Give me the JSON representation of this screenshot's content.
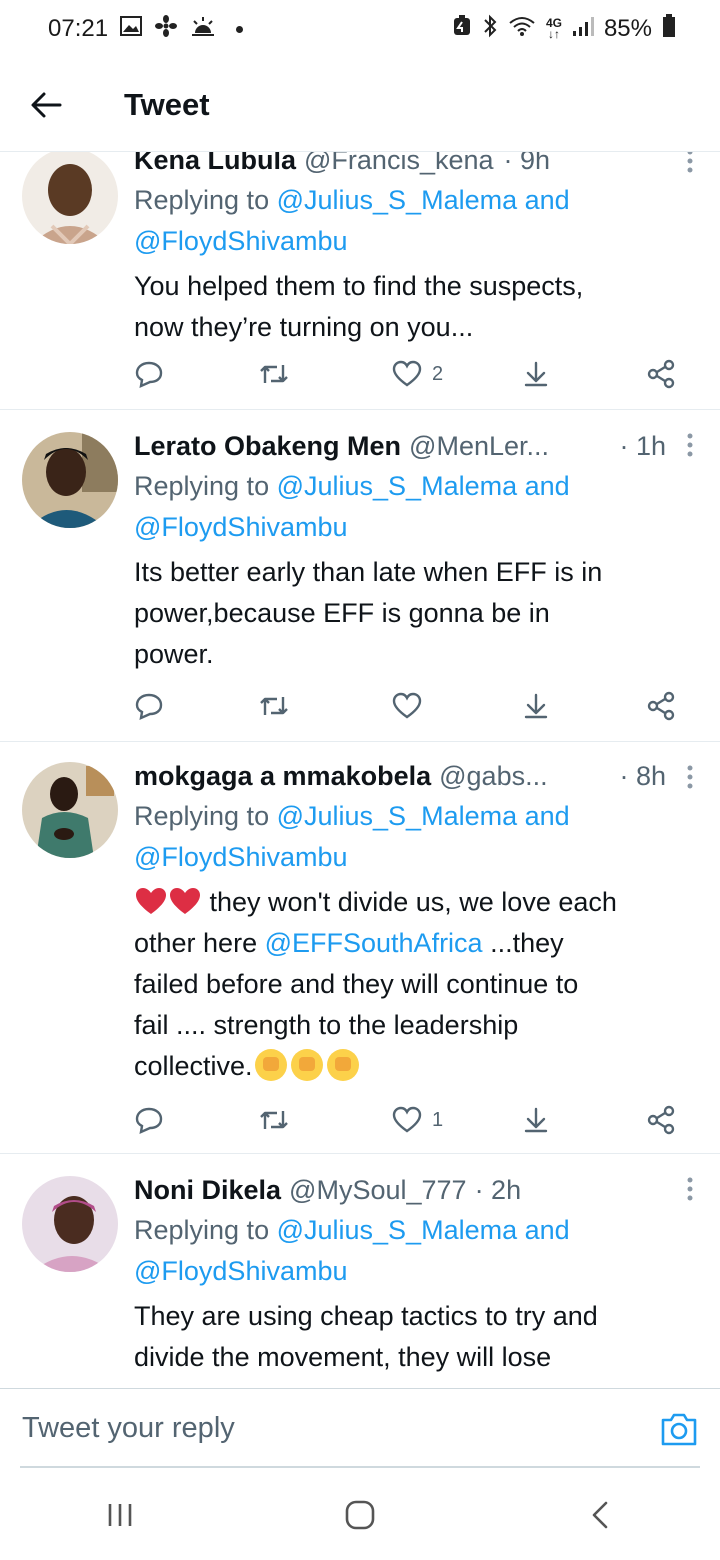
{
  "status_bar": {
    "time": "07:21",
    "left_icons": [
      "gallery-icon",
      "fan-icon",
      "weather-icon",
      "notification-dot"
    ],
    "right_icons": [
      "battery-saver-icon",
      "bluetooth-icon",
      "wifi-icon",
      "network-4g-icon",
      "signal-icon"
    ],
    "network": "4G",
    "battery": "85%"
  },
  "header": {
    "title": "Tweet",
    "back_icon": "arrow-left-icon"
  },
  "tweets": [
    {
      "name": "Kena Lubula",
      "handle": "@Francis_kena",
      "time": "· 9h",
      "reply_prefix": "Replying to ",
      "reply_user1": "@Julius_S_Malema",
      "reply_and": " and",
      "reply_user2": "@FloydShivambu",
      "text_lines": [
        "You helped them to find the suspects,",
        "now they’re turning on you..."
      ],
      "likes": "2"
    },
    {
      "name": "Lerato Obakeng Men",
      "handle": "@MenLer...",
      "time": "· 1h",
      "reply_prefix": "Replying to ",
      "reply_user1": "@Julius_S_Malema",
      "reply_and": " and",
      "reply_user2": "@FloydShivambu",
      "text_lines": [
        "Its better early than late when EFF is in",
        "power,because EFF is gonna be in",
        "power."
      ],
      "likes": ""
    },
    {
      "name": "mokgaga a mmakobela",
      "handle": "@gabs...",
      "time": "· 8h",
      "reply_prefix": "Replying to ",
      "reply_user1": "@Julius_S_Malema",
      "reply_and": " and",
      "reply_user2": "@FloydShivambu",
      "text_line1": " they won't divide us, we love each",
      "text_line2_pre": "other here ",
      "text_mention": "@EFFSouthAfrica",
      "text_line2_post": " ...they",
      "text_lines_rest": [
        "failed before and they will continue to",
        "fail .... strength to the leadership"
      ],
      "text_last": "collective.",
      "likes": "1"
    },
    {
      "name": "Noni Dikela",
      "handle": "@MySoul_777",
      "time": "· 2h",
      "reply_prefix": "Replying to ",
      "reply_user1": "@Julius_S_Malema",
      "reply_and": " and",
      "reply_user2": "@FloydShivambu",
      "text_lines": [
        "They are using cheap tactics to try and",
        "divide the movement, they will lose"
      ]
    }
  ],
  "reply_bar": {
    "placeholder": "Tweet your reply",
    "camera_icon": "camera-icon"
  },
  "nav_bar": {
    "buttons": [
      "recent-apps-icon",
      "home-icon",
      "back-icon"
    ]
  },
  "colors": {
    "link": "#1d9bf0",
    "secondary_text": "#536471",
    "primary_text": "#0f1419",
    "divider": "#e6ecf0"
  }
}
